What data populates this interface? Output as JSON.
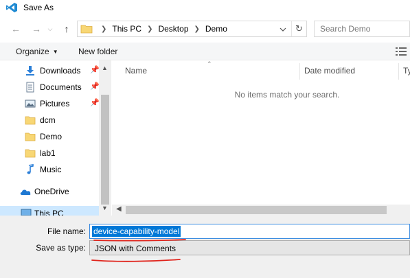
{
  "window": {
    "title": "Save As"
  },
  "address": {
    "crumbs": [
      "This PC",
      "Desktop",
      "Demo"
    ]
  },
  "search": {
    "placeholder": "Search Demo"
  },
  "toolbar": {
    "organize_label": "Organize",
    "new_folder_label": "New folder"
  },
  "sidebar": {
    "items": [
      {
        "label": "Downloads",
        "icon": "download-icon",
        "pinned": true
      },
      {
        "label": "Documents",
        "icon": "documents-icon",
        "pinned": true
      },
      {
        "label": "Pictures",
        "icon": "pictures-icon",
        "pinned": true
      },
      {
        "label": "dcm",
        "icon": "folder-icon",
        "pinned": false
      },
      {
        "label": "Demo",
        "icon": "folder-icon",
        "pinned": false
      },
      {
        "label": "lab1",
        "icon": "folder-icon",
        "pinned": false
      },
      {
        "label": "Music",
        "icon": "music-icon",
        "pinned": false
      },
      {
        "label": "OneDrive",
        "icon": "cloud-icon",
        "pinned": false
      },
      {
        "label": "This PC",
        "icon": "computer-icon",
        "pinned": false,
        "selected": true
      }
    ]
  },
  "columns": {
    "name": "Name",
    "date_modified": "Date modified",
    "type": "Ty"
  },
  "content": {
    "empty_message": "No items match your search."
  },
  "form": {
    "file_name_label": "File name:",
    "file_name_value": "device-capability-model",
    "save_type_label": "Save as type:",
    "save_type_value": "JSON with Comments"
  },
  "colors": {
    "accent": "#0078d7",
    "selected_bg": "#cde8ff",
    "annotation": "#e0241c",
    "folder": "#f8d775"
  }
}
